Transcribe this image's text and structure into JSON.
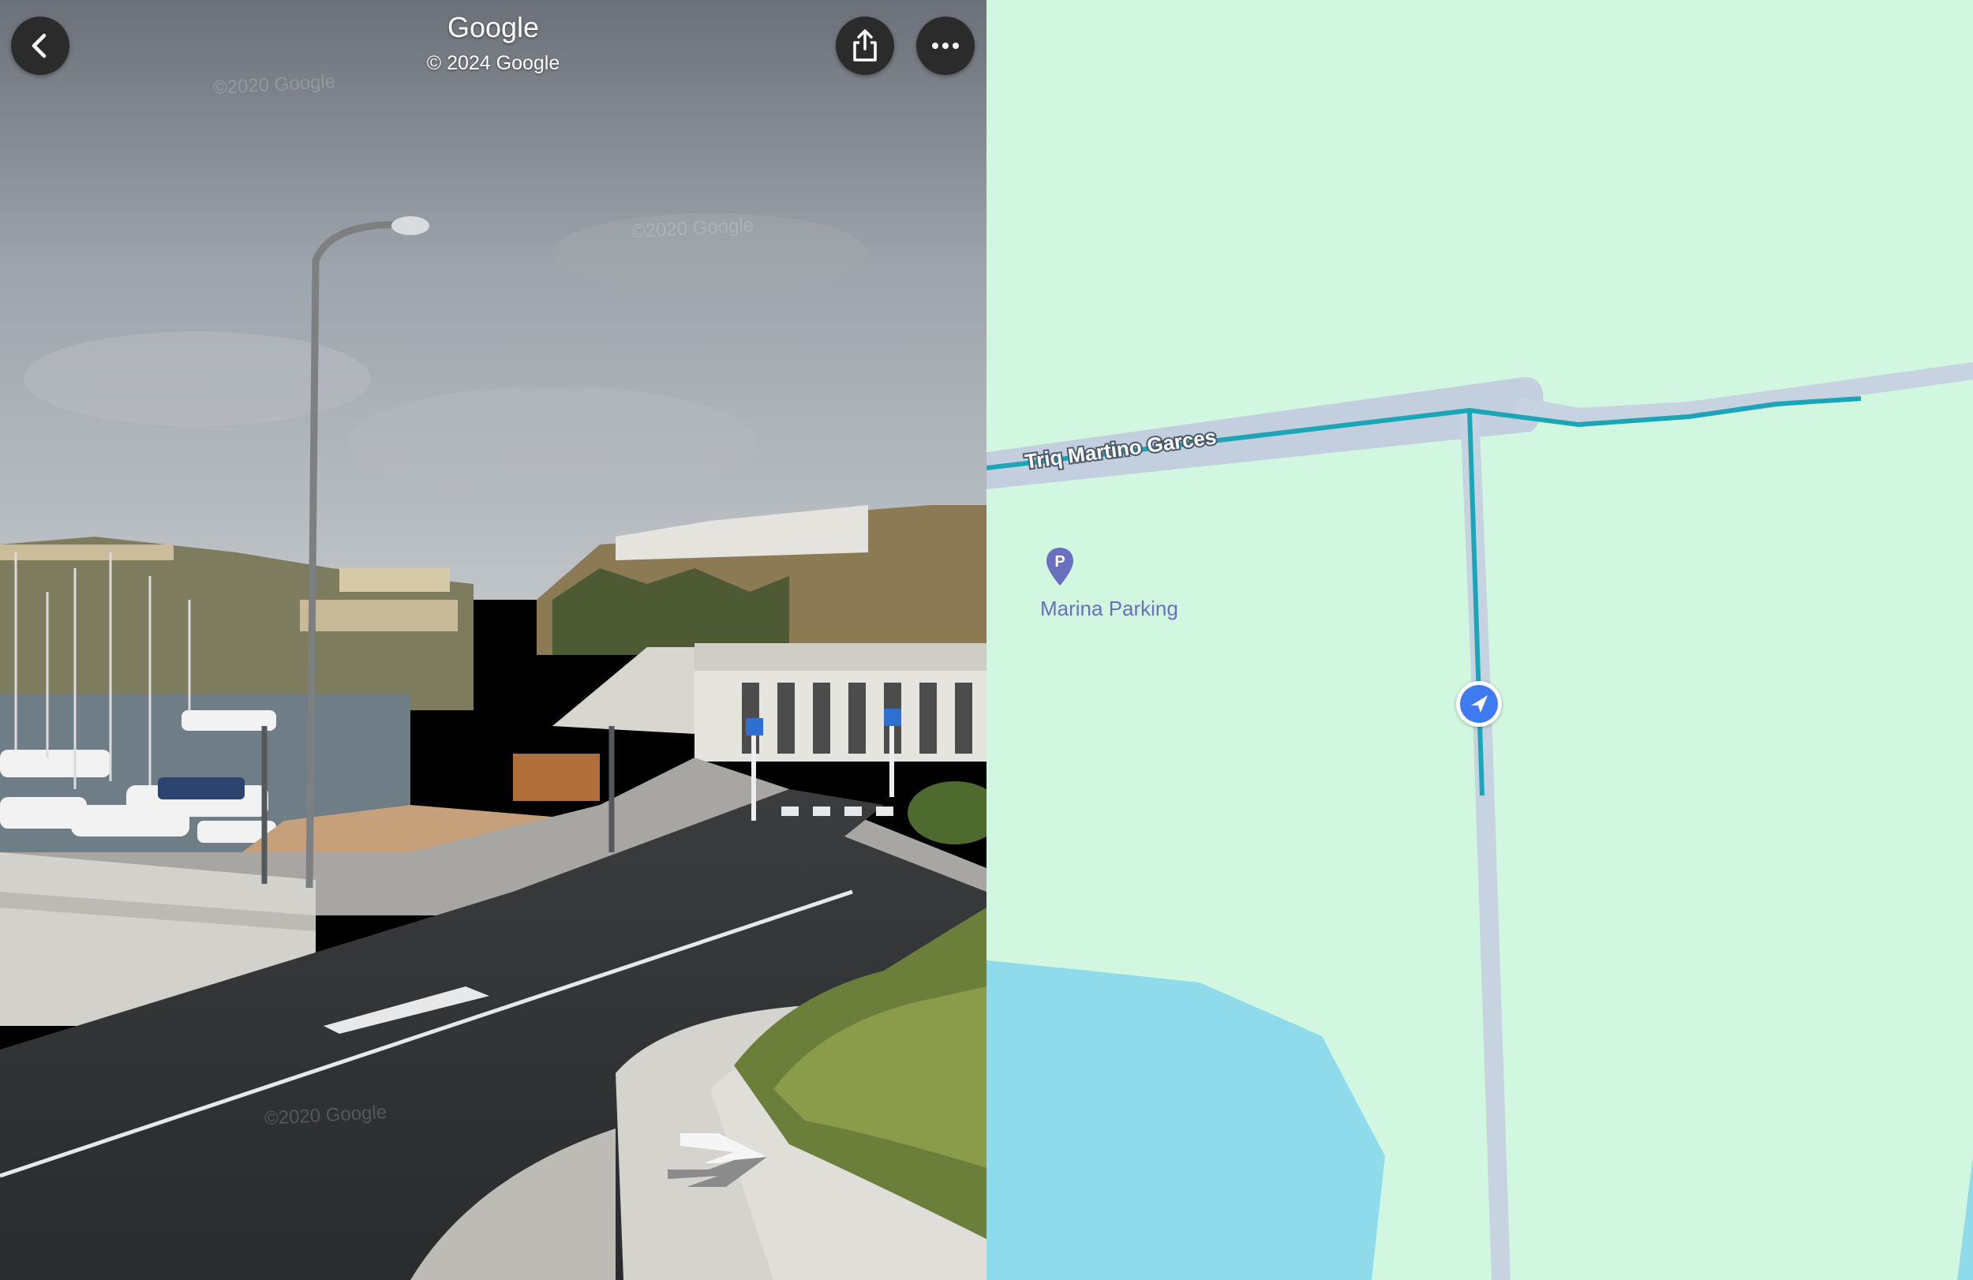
{
  "street_view": {
    "title": "Google",
    "copyright": "© 2024 Google",
    "watermarks": [
      "©2020 Google",
      "©2020 Google",
      "©2020 Google"
    ],
    "back_icon": "chevron-left-icon",
    "share_icon": "share-icon",
    "more_icon": "more-horizontal-icon",
    "nav_arrow_icon": "forward-arrow-icon"
  },
  "map": {
    "street_name": "Triq Martino Garces",
    "poi": {
      "label": "Marina Parking",
      "icon": "parking-pin-icon"
    },
    "location_icon": "navigation-arrow-icon",
    "colors": {
      "land": "#d2f7e0",
      "water": "#8fdbeb",
      "road": "#c7d3e0",
      "street_view_line": "#1aa6b7",
      "poi": "#6a6fbf",
      "location": "#3e7bf0"
    }
  }
}
